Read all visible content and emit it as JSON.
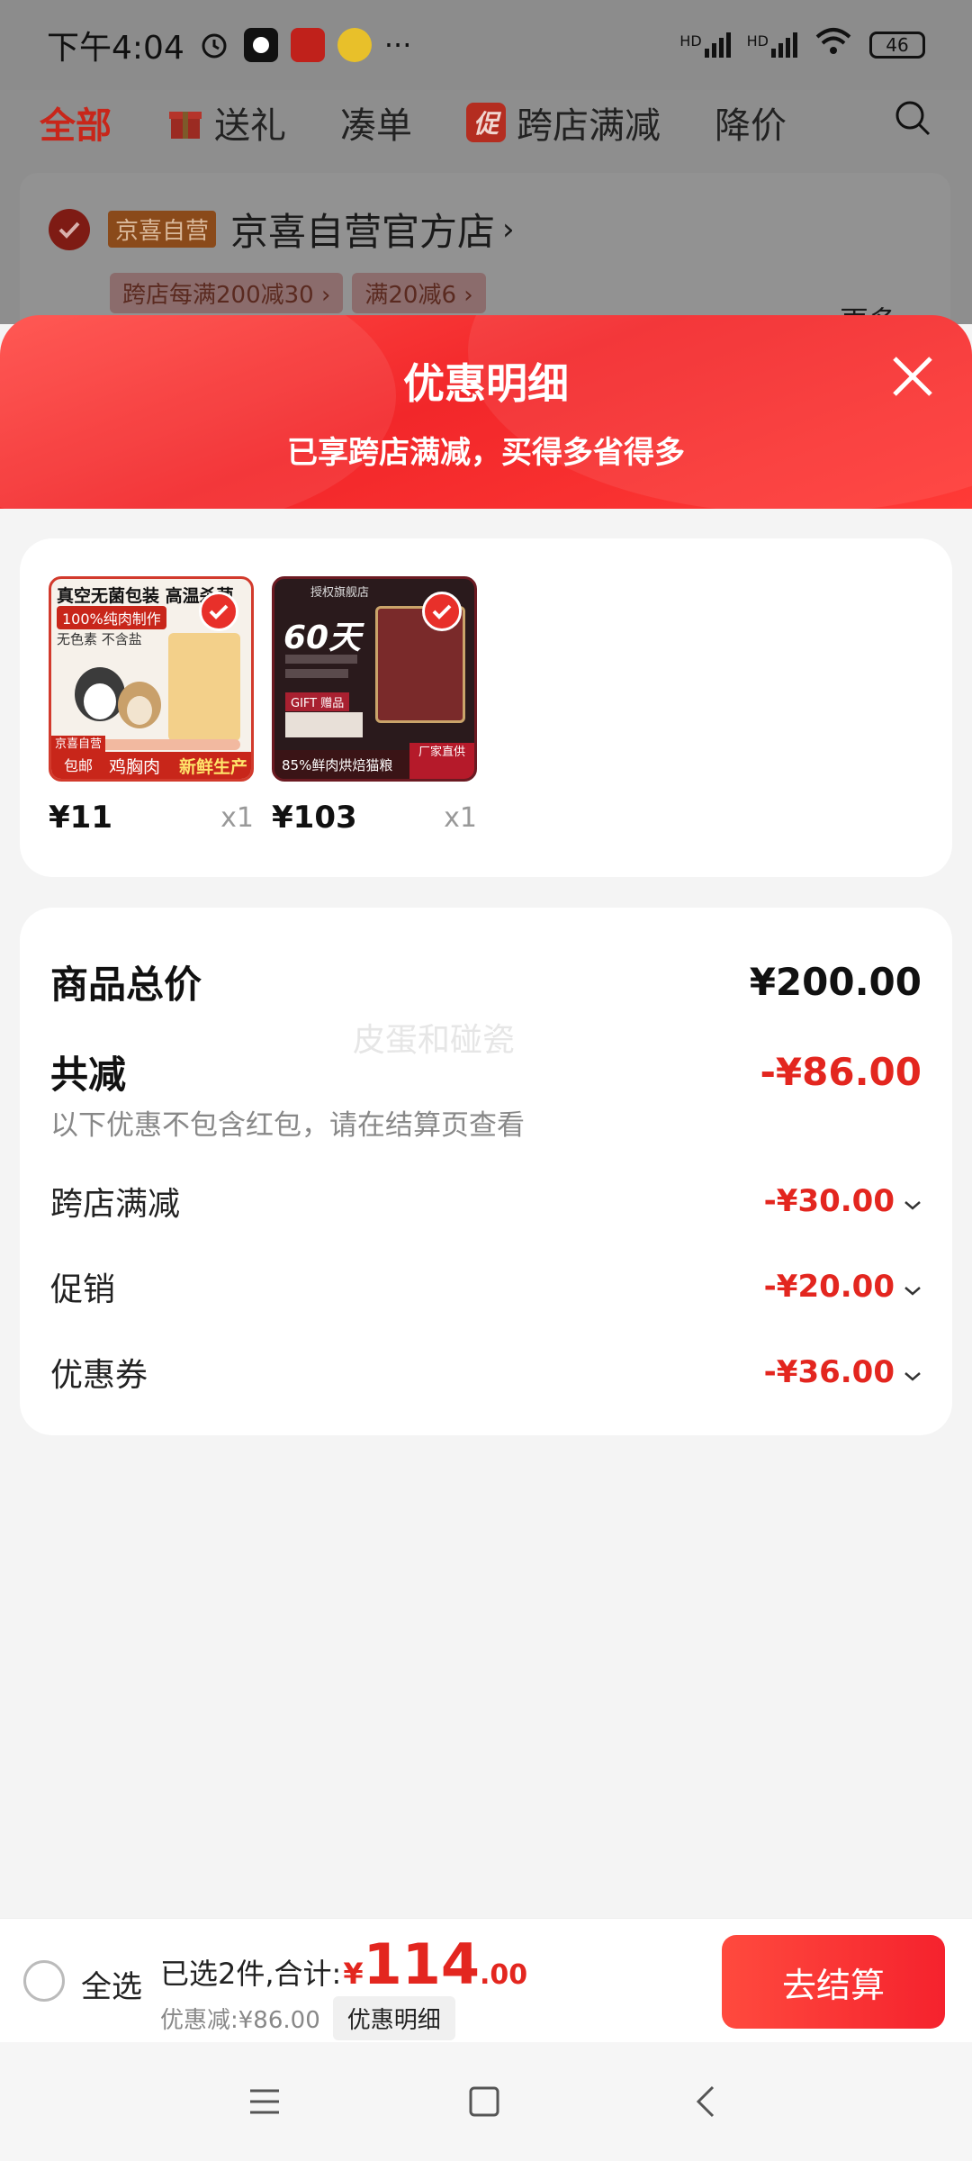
{
  "status_bar": {
    "time": "下午4:04",
    "more": "···",
    "battery": "46",
    "signal_label_1": "HD",
    "signal_label_2": "HD"
  },
  "bg_page": {
    "tabs": [
      {
        "label": "全部",
        "active": true
      },
      {
        "label": "送礼",
        "icon": "gift-icon"
      },
      {
        "label": "凑单"
      },
      {
        "label": "跨店满减",
        "badge": "促"
      },
      {
        "label": "降价"
      }
    ],
    "store": {
      "badge": "京喜自营",
      "name": "京喜自营官方店",
      "chevron": "›",
      "promos": [
        "跨店每满200减30 ›",
        "满20减6 ›"
      ],
      "more": "更多 ›"
    }
  },
  "sheet": {
    "title": "优惠明细",
    "subtitle": "已享跨店满减，买得多省得多"
  },
  "products": [
    {
      "price": "¥11",
      "qty": "x1",
      "image_text": {
        "top": "真空无菌包装 高温杀菌",
        "tag": "100%纯肉制作",
        "sub": "无色素 不含盐",
        "store_badge": "京喜自营",
        "ship": "包邮",
        "bottom_left": "鸡胸肉",
        "bottom_right": "新鲜生产"
      }
    },
    {
      "price": "¥103",
      "qty": "x1",
      "image_text": {
        "store": "授权旗舰店",
        "days": "60天",
        "gift": "GIFT 赠品",
        "bottom": "85%鲜肉烘焙猫粮",
        "factory": "厂家直供"
      }
    }
  ],
  "summary": {
    "total_label": "商品总价",
    "total_value": "¥200.00",
    "discount_label": "共减",
    "discount_value": "-¥86.00",
    "watermark": "皮蛋和碰瓷",
    "note": "以下优惠不包含红包，请在结算页查看",
    "items": [
      {
        "label": "跨店满减",
        "value": "-¥30.00"
      },
      {
        "label": "促销",
        "value": "-¥20.00"
      },
      {
        "label": "优惠券",
        "value": "-¥36.00"
      }
    ]
  },
  "bottom_bar": {
    "select_all": "全选",
    "selected_text": "已选2件,合计:",
    "currency": "¥",
    "total_int": "114",
    "total_dec": ".00",
    "discount_text": "优惠减:¥86.00",
    "detail_link": "优惠明细",
    "checkout": "去结算"
  },
  "colors": {
    "accent": "#e3261f",
    "header_red": "#f2272a",
    "background": "#f4f4f4"
  }
}
